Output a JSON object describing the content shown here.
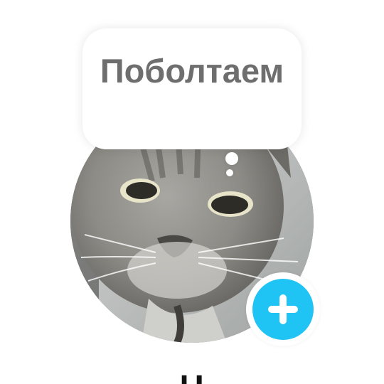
{
  "bubble": {
    "text": "Поболтаем"
  },
  "profile": {
    "name": "Ч"
  },
  "add_button": {
    "icon": "plus-icon"
  },
  "colors": {
    "accent": "#20c4f4",
    "bubble_text": "#6e6e6e",
    "background": "#ffffff"
  }
}
